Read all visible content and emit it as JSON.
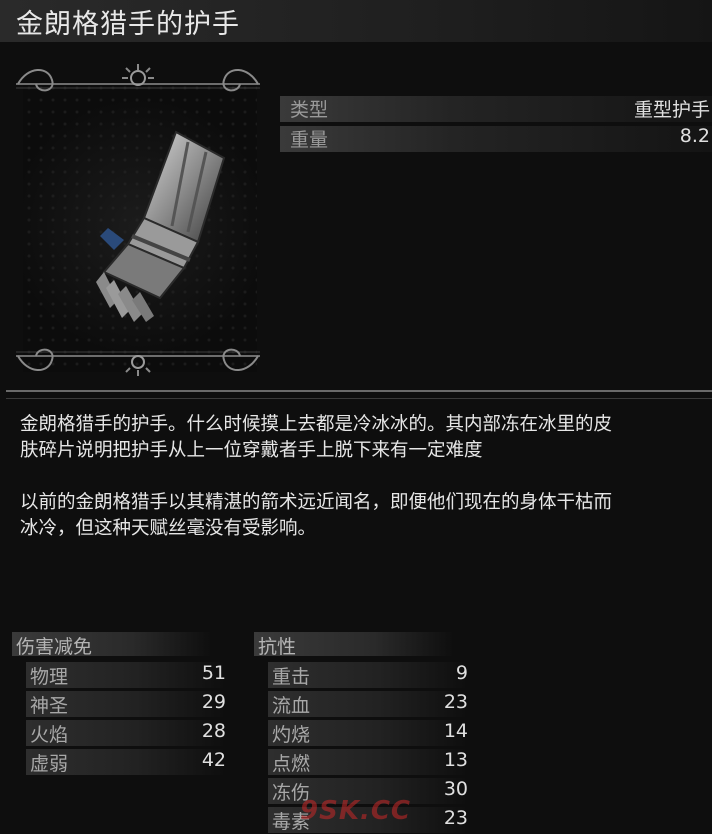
{
  "title": "金朗格猎手的护手",
  "info": [
    {
      "label": "类型",
      "value": "重型护手"
    },
    {
      "label": "重量",
      "value": "8.2"
    }
  ],
  "description": [
    "金朗格猎手的护手。什么时候摸上去都是冷冰冰的。其内部冻在冰里的皮",
    "肤碎片说明把护手从上一位穿戴者手上脱下来有一定难度",
    "以前的金朗格猎手以其精湛的箭术远近闻名，即便他们现在的身体干枯而",
    "冰冷，但这种天赋丝毫没有受影响。"
  ],
  "damage_reduction": {
    "heading": "伤害减免",
    "rows": [
      {
        "name": "物理",
        "value": "51"
      },
      {
        "name": "神圣",
        "value": "29"
      },
      {
        "name": "火焰",
        "value": "28"
      },
      {
        "name": "虚弱",
        "value": "42"
      }
    ]
  },
  "resistance": {
    "heading": "抗性",
    "rows": [
      {
        "name": "重击",
        "value": "9"
      },
      {
        "name": "流血",
        "value": "23"
      },
      {
        "name": "灼烧",
        "value": "14"
      },
      {
        "name": "点燃",
        "value": "13"
      },
      {
        "name": "冻伤",
        "value": "30"
      },
      {
        "name": "毒素",
        "value": "23"
      }
    ]
  },
  "watermark": "9SK.CC",
  "icons": {
    "item": "gauntlet-icon",
    "frame": "ornate-frame"
  }
}
